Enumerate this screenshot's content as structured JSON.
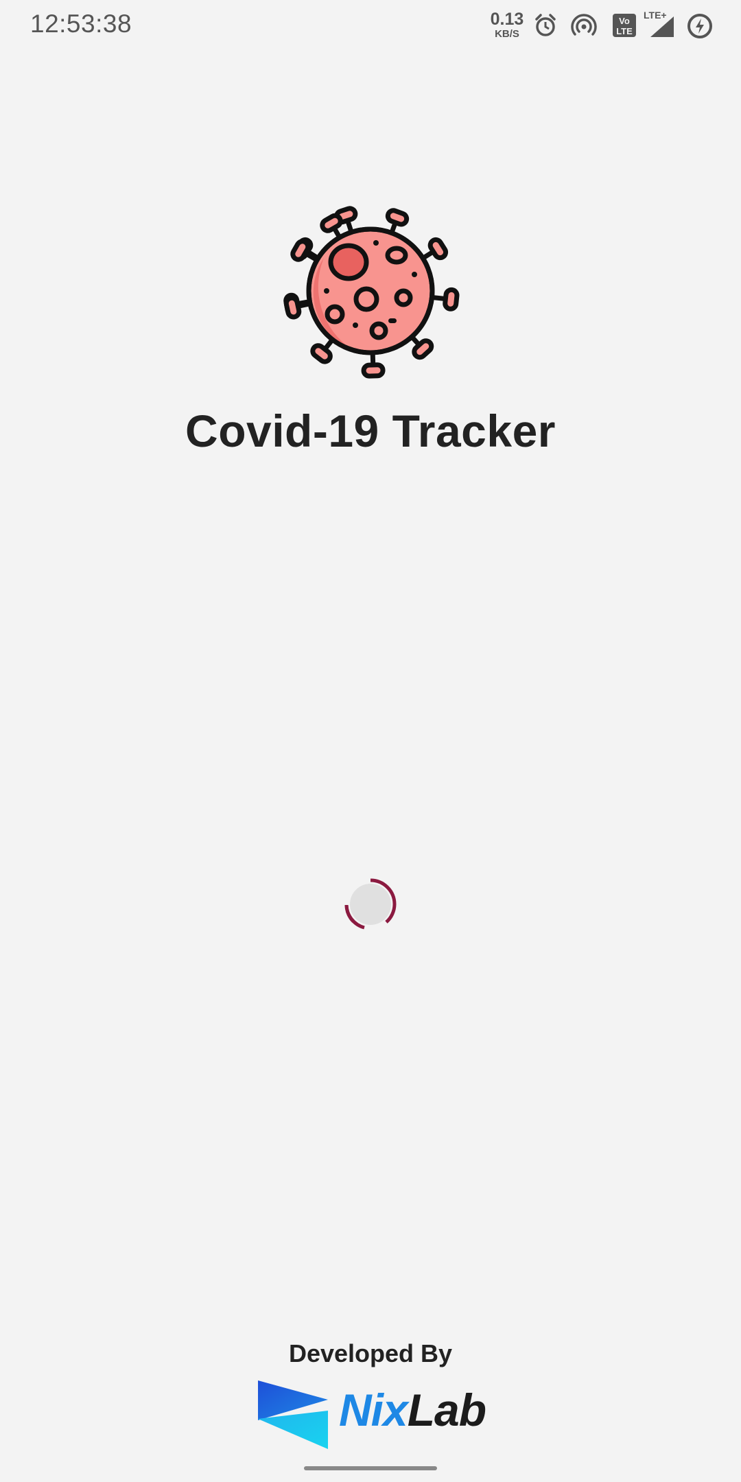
{
  "status_bar": {
    "time": "12:53:38",
    "net_speed_value": "0.13",
    "net_speed_unit": "KB/S",
    "volte_label": "Vo LTE",
    "lte_label": "LTE+",
    "icons": [
      "alarm-icon",
      "hotspot-icon",
      "volte-icon",
      "signal-icon",
      "battery-saver-icon"
    ]
  },
  "app": {
    "logo_icon": "virus-icon",
    "title": "Covid-19 Tracker"
  },
  "loader": {
    "icon": "loading-spinner",
    "accent_color": "#8b1a40"
  },
  "footer": {
    "developed_by": "Developed By",
    "brand_prefix": "Nix",
    "brand_suffix": "Lab",
    "brand_color": "#1e88e5"
  },
  "colors": {
    "background": "#f3f3f3",
    "virus_body": "#f8948f",
    "virus_dark": "#e8625f",
    "outline": "#111111"
  }
}
